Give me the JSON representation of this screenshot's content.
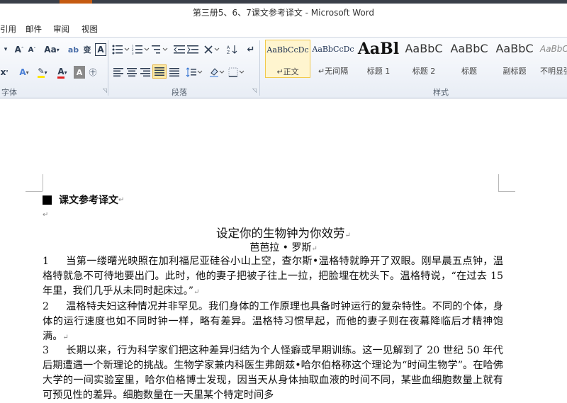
{
  "window": {
    "title": "第三册5、6、7课文参考译文 - Microsoft Word"
  },
  "menu": [
    "引用",
    "邮件",
    "审阅",
    "视图"
  ],
  "ribbon": {
    "groups": {
      "font": "字体",
      "paragraph": "段落",
      "styles": "样式"
    },
    "styles": [
      {
        "sample": "AaBbCcDc",
        "name": "↵正文",
        "selected": true
      },
      {
        "sample": "AaBbCcDc",
        "name": "↵无间隔",
        "selected": false
      },
      {
        "sample": "AaBl",
        "name": "标题 1",
        "selected": false
      },
      {
        "sample": "AaBbC",
        "name": "标题 2",
        "selected": false
      },
      {
        "sample": "AaBbC",
        "name": "标题",
        "selected": false
      },
      {
        "sample": "AaBbC",
        "name": "副标题",
        "selected": false
      },
      {
        "sample": "AaBbC",
        "name": "不明显强",
        "selected": false
      }
    ]
  },
  "document": {
    "heading": "课文参考译文",
    "title": "设定你的生物钟为你效劳",
    "author": "芭芭拉 • 罗斯",
    "paragraphs": [
      {
        "num": "1",
        "text": "当第一缕曙光映照在加利福尼亚硅谷小山上空，查尔斯•温格特就睁开了双眼。刚早晨五点钟，温格特就急不可待地要出门。此时，他的妻子把被子往上一拉，把脸埋在枕头下。温格特说，“在过去 15 年里，我们几乎从未同时起床过。”"
      },
      {
        "num": "2",
        "text": "温格特夫妇这种情况并非罕见。我们身体的工作原理也具备时钟运行的复杂特性。不同的个体，身体的运行速度也如不同时钟一样，略有差异。温格特习惯早起，而他的妻子则在夜幕降临后才精神饱满。"
      },
      {
        "num": "3",
        "text": "长期以来，行为科学家们把这种差异归结为个人怪癖或早期训练。这一见解到了 20 世纪 50 年代后期遭遇一个新理论的挑战。生物学家兼内科医生弗朗兹•哈尔伯格称这个理论为“时间生物学”。在哈佛大学的一间实验室里，哈尔伯格博士发现，因当天从身体抽取血液的时间不同，某些血细胞数量上就有可预见性的差异。细胞数量在一天里某个特定时间多"
      }
    ]
  }
}
